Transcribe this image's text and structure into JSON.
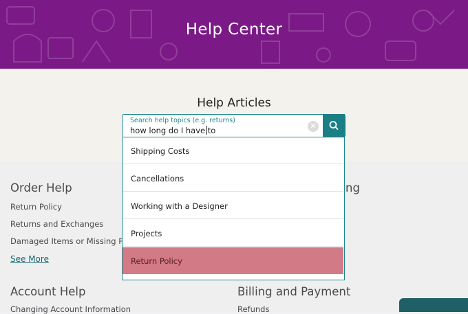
{
  "header": {
    "title": "Help Center"
  },
  "articles": {
    "title": "Help Articles"
  },
  "search": {
    "label": "Search help topics (e.g. returns)",
    "value": "how long do I have to",
    "clear_icon": "clear-icon",
    "button_icon": "search-icon"
  },
  "suggestions": [
    {
      "label": "Shipping Costs"
    },
    {
      "label": "Cancellations"
    },
    {
      "label": "Working with a Designer"
    },
    {
      "label": "Projects"
    },
    {
      "label": "Return Policy",
      "highlighted": true
    }
  ],
  "order_help": {
    "title": "Order Help",
    "links": [
      "Return Policy",
      "Returns and Exchanges",
      "Damaged Items or Missing Part"
    ],
    "see_more": "See More"
  },
  "partial_section": {
    "title_fragment": "ng"
  },
  "account_help": {
    "title": "Account Help",
    "links": [
      "Changing Account Information"
    ]
  },
  "billing": {
    "title": "Billing and Payment",
    "links": [
      "Refunds"
    ]
  },
  "colors": {
    "header": "#7b1a86",
    "accent": "#1b7f86",
    "highlight": "#d27a86"
  }
}
